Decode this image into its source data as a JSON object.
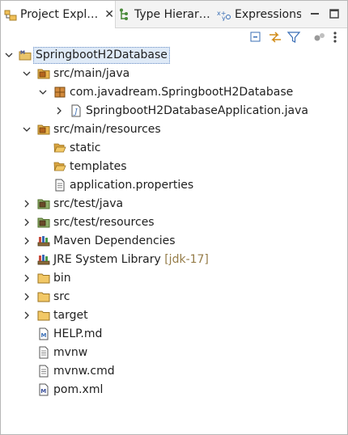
{
  "tabs": [
    {
      "label": "Project Expl…",
      "icon": "project-explorer-icon",
      "active": true
    },
    {
      "label": "Type Hierar…",
      "icon": "type-hierarchy-icon",
      "active": false
    },
    {
      "label": "Expressions",
      "icon": "expressions-icon",
      "active": false
    }
  ],
  "tab_close_glyph": "✕",
  "tree": {
    "root": {
      "label": "SpringbootH2Database",
      "expanded": true,
      "selected": true
    },
    "src_main_java": {
      "label": "src/main/java",
      "expanded": true
    },
    "package": {
      "label": "com.javadream.SpringbootH2Database",
      "expanded": true
    },
    "app_class": {
      "label": "SpringbootH2DatabaseApplication.java",
      "expanded": false
    },
    "src_main_resources": {
      "label": "src/main/resources",
      "expanded": true
    },
    "static": {
      "label": "static"
    },
    "templates": {
      "label": "templates"
    },
    "app_props": {
      "label": "application.properties"
    },
    "src_test_java": {
      "label": "src/test/java",
      "expanded": false
    },
    "src_test_resources": {
      "label": "src/test/resources",
      "expanded": false
    },
    "maven_deps": {
      "label": "Maven Dependencies",
      "expanded": false
    },
    "jre": {
      "label": "JRE System Library",
      "decoration": "[jdk-17]",
      "expanded": false
    },
    "bin": {
      "label": "bin",
      "expanded": false
    },
    "src": {
      "label": "src",
      "expanded": false
    },
    "target": {
      "label": "target",
      "expanded": false
    },
    "help_md": {
      "label": "HELP.md"
    },
    "mvnw": {
      "label": "mvnw"
    },
    "mvnw_cmd": {
      "label": "mvnw.cmd"
    },
    "pom": {
      "label": "pom.xml"
    }
  },
  "colors": {
    "selection_bg": "#dfeaf7",
    "decoration": "#957c48",
    "folder": "#e8b64a",
    "package": "#b5651d",
    "java_file": "#3b6fb6"
  }
}
